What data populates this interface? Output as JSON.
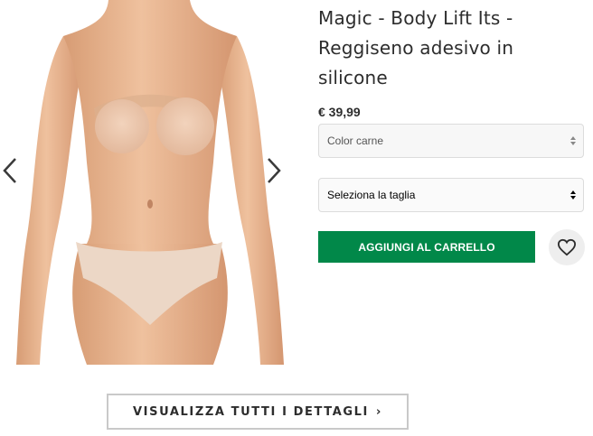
{
  "product": {
    "title": "Magic - Body Lift Its - Reggiseno adesivo in silicone",
    "price": "€ 39,99",
    "image_alt": "Model wearing nude silicone adhesive bra"
  },
  "options": {
    "color_value": "Color carne",
    "size_placeholder": "Seleziona la taglia"
  },
  "actions": {
    "add_to_cart": "AGGIUNGI AL CARRELLO",
    "view_details": "VISUALIZZA TUTTI I DETTAGLI",
    "view_details_caret": "›"
  },
  "icons": {
    "prev": "chevron-left-icon",
    "next": "chevron-right-icon",
    "save": "heart-icon",
    "select": "up-down-caret-icon"
  },
  "colors": {
    "accent_green": "#018849",
    "skin": "#e8b48f",
    "text": "#2d2d2d"
  }
}
